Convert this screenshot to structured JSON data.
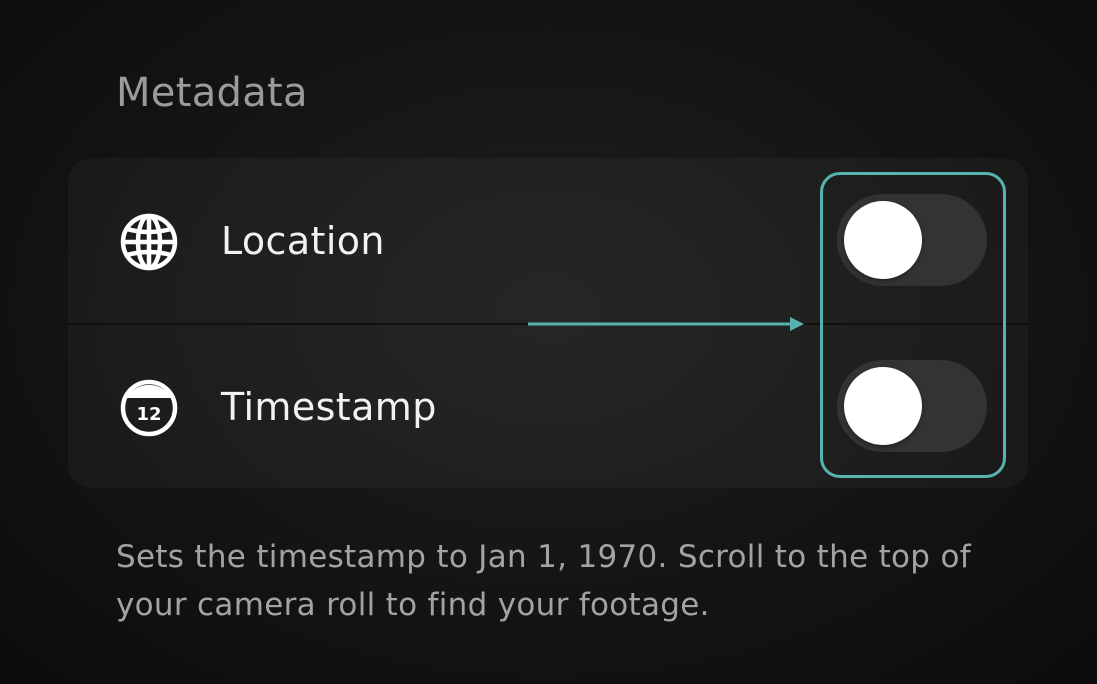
{
  "section": {
    "title": "Metadata"
  },
  "settings": [
    {
      "icon": "globe-icon",
      "label": "Location",
      "toggle_on": false
    },
    {
      "icon": "calendar-icon",
      "label": "Timestamp",
      "icon_text": "12",
      "toggle_on": false
    }
  ],
  "footnote": "Sets the timestamp to Jan 1, 1970. Scroll to the top of your camera roll to find your footage.",
  "colors": {
    "background": "#141414",
    "card": "#1c1c1c",
    "toggle_track_off": "#333334",
    "toggle_knob": "#ffffff",
    "annotation": "#57b3ad",
    "title_text": "#9b9b9b",
    "label_text": "#f2f2f2",
    "footnote_text": "#a3a3a3"
  }
}
